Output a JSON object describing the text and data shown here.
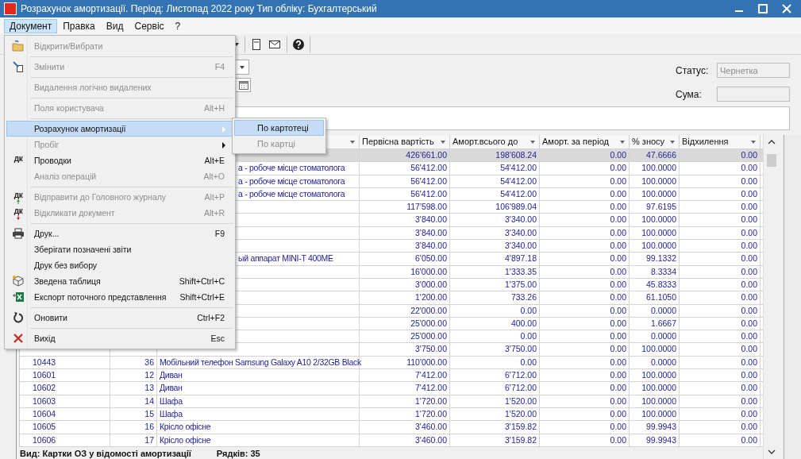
{
  "window": {
    "title": "Розрахунок амортизації. Період: Листопад 2022 року Тип обліку: Бухгалтерський"
  },
  "menubar": [
    {
      "label": "Документ",
      "selected": true
    },
    {
      "label": "Правка",
      "selected": false
    },
    {
      "label": "Вид",
      "selected": false
    },
    {
      "label": "Сервіс",
      "selected": false
    },
    {
      "label": "?",
      "selected": false
    }
  ],
  "menu": {
    "items": [
      {
        "kind": "item",
        "label": "Відкрити/Вибрати",
        "disabled": true,
        "selected": false,
        "submenu": false
      },
      {
        "kind": "separator"
      },
      {
        "kind": "item",
        "label": "Змінити",
        "shortcut": "F4",
        "disabled": true,
        "selected": false,
        "submenu": false
      },
      {
        "kind": "separator"
      },
      {
        "kind": "item",
        "label": "Видалення логічно видалених",
        "disabled": true,
        "selected": false,
        "submenu": false
      },
      {
        "kind": "separator"
      },
      {
        "kind": "item",
        "label": "Поля користувача",
        "shortcut": "Alt+H",
        "disabled": true,
        "selected": false,
        "submenu": false
      },
      {
        "kind": "separator"
      },
      {
        "kind": "item",
        "label": "Розрахунок амортизації",
        "disabled": false,
        "selected": true,
        "submenu": true
      },
      {
        "kind": "item",
        "label": "Пробіг",
        "disabled": true,
        "selected": false,
        "submenu": true
      },
      {
        "kind": "item",
        "label": "Проводки",
        "shortcut": "Alt+E",
        "icon_text": "дк",
        "disabled": false,
        "selected": false,
        "submenu": false
      },
      {
        "kind": "item",
        "label": "Аналіз операцій",
        "shortcut": "Alt+O",
        "disabled": true,
        "selected": false,
        "submenu": false
      },
      {
        "kind": "separator"
      },
      {
        "kind": "item",
        "label": "Відправити до Головного журналу",
        "shortcut": "Alt+P",
        "icon_text": "дк",
        "disabled": true,
        "selected": false,
        "submenu": false
      },
      {
        "kind": "item",
        "label": "Відкликати документ",
        "shortcut": "Alt+R",
        "icon_text": "дк",
        "disabled": true,
        "selected": false,
        "submenu": false
      },
      {
        "kind": "separator"
      },
      {
        "kind": "item",
        "label": "Друк...",
        "shortcut": "F9",
        "disabled": false,
        "selected": false,
        "submenu": false
      },
      {
        "kind": "item",
        "label": "Зберігати позначені звіти",
        "disabled": false,
        "selected": false,
        "submenu": false
      },
      {
        "kind": "item",
        "label": "Друк без вибору",
        "disabled": false,
        "selected": false,
        "submenu": false
      },
      {
        "kind": "item",
        "label": "Зведена таблиця",
        "shortcut": "Shift+Ctrl+C",
        "disabled": false,
        "selected": false,
        "submenu": false
      },
      {
        "kind": "item",
        "label": "Експорт поточного представлення",
        "shortcut": "Shift+Ctrl+E",
        "disabled": false,
        "selected": false,
        "submenu": false
      },
      {
        "kind": "separator"
      },
      {
        "kind": "item",
        "label": "Оновити",
        "shortcut": "Ctrl+F2",
        "disabled": false,
        "selected": false,
        "submenu": false
      },
      {
        "kind": "separator"
      },
      {
        "kind": "item",
        "label": "Вихід",
        "shortcut": "Esc",
        "disabled": false,
        "selected": false,
        "submenu": false
      }
    ]
  },
  "submenu": [
    {
      "label": "По картотеці",
      "selected": true,
      "disabled": false
    },
    {
      "label": "По картці",
      "selected": false,
      "disabled": true
    }
  ],
  "form": {
    "status_label": "Статус:",
    "status_value": "Чернетка",
    "sum_label": "Сума:"
  },
  "table": {
    "columns": [
      "Первісна вартість",
      "Аморт.всього до",
      "Аморт. за період",
      "% зносу",
      "Відхилення"
    ],
    "rows": [
      {
        "selected": true,
        "values": [
          "426'661.00",
          "198'608.24",
          "0.00",
          "47.6666",
          "0.00"
        ]
      },
      {
        "covered": true,
        "selected": false,
        "name": "а - робоче місце стоматолога",
        "values": [
          "56'412.00",
          "54'412.00",
          "0.00",
          "100.0000",
          "0.00"
        ]
      },
      {
        "covered": true,
        "selected": false,
        "name": "а - робоче місце стоматолога",
        "values": [
          "56'412.00",
          "54'412.00",
          "0.00",
          "100.0000",
          "0.00"
        ]
      },
      {
        "covered": true,
        "selected": false,
        "name": "а - робоче місце стоматолога",
        "values": [
          "56'412.00",
          "54'412.00",
          "0.00",
          "100.0000",
          "0.00"
        ]
      },
      {
        "selected": false,
        "values": [
          "117'598.00",
          "106'989.04",
          "0.00",
          "97.6195",
          "0.00"
        ]
      },
      {
        "selected": false,
        "values": [
          "3'840.00",
          "3'340.00",
          "0.00",
          "100.0000",
          "0.00"
        ]
      },
      {
        "selected": false,
        "values": [
          "3'840.00",
          "3'340.00",
          "0.00",
          "100.0000",
          "0.00"
        ]
      },
      {
        "selected": false,
        "values": [
          "3'840.00",
          "3'340.00",
          "0.00",
          "100.0000",
          "0.00"
        ]
      },
      {
        "covered": true,
        "selected": false,
        "name": "ый аппарат MINI-T 400ME",
        "values": [
          "6'050.00",
          "4'897.18",
          "0.00",
          "99.1332",
          "0.00"
        ]
      },
      {
        "selected": false,
        "values": [
          "16'000.00",
          "1'333.35",
          "0.00",
          "8.3334",
          "0.00"
        ]
      },
      {
        "selected": false,
        "values": [
          "3'000.00",
          "1'375.00",
          "0.00",
          "45.8333",
          "0.00"
        ]
      },
      {
        "selected": false,
        "values": [
          "1'200.00",
          "733.26",
          "0.00",
          "61.1050",
          "0.00"
        ]
      },
      {
        "selected": false,
        "values": [
          "22'000.00",
          "0.00",
          "0.00",
          "0.0000",
          "0.00"
        ]
      },
      {
        "selected": false,
        "values": [
          "25'000.00",
          "400.00",
          "0.00",
          "1.6667",
          "0.00"
        ]
      },
      {
        "selected": false,
        "values": [
          "25'000.00",
          "0.00",
          "0.00",
          "0.0000",
          "0.00"
        ]
      },
      {
        "selected": false,
        "values": [
          "3'750.00",
          "3'750.00",
          "0.00",
          "100.0000",
          "0.00"
        ]
      },
      {
        "covered": false,
        "selected": false,
        "code": "10443",
        "number": "36",
        "name": "Мобільний телефон Samsung Galaxy A10 2/32GB Black",
        "values": [
          "110'000.00",
          "0.00",
          "0.00",
          "0.0000",
          "0.00"
        ]
      },
      {
        "covered": false,
        "selected": false,
        "code": "10601",
        "number": "12",
        "name": "Диван",
        "values": [
          "7'412.00",
          "6'712.00",
          "0.00",
          "100.0000",
          "0.00"
        ]
      },
      {
        "covered": false,
        "selected": false,
        "code": "10602",
        "number": "13",
        "name": "Диван",
        "values": [
          "7'412.00",
          "6'712.00",
          "0.00",
          "100.0000",
          "0.00"
        ]
      },
      {
        "covered": false,
        "selected": false,
        "code": "10603",
        "number": "14",
        "name": "Шафа",
        "values": [
          "1'720.00",
          "1'520.00",
          "0.00",
          "100.0000",
          "0.00"
        ]
      },
      {
        "covered": false,
        "selected": false,
        "code": "10604",
        "number": "15",
        "name": "Шафа",
        "values": [
          "1'720.00",
          "1'520.00",
          "0.00",
          "100.0000",
          "0.00"
        ]
      },
      {
        "covered": false,
        "selected": false,
        "code": "10605",
        "number": "16",
        "name": "Крісло офісне",
        "values": [
          "3'460.00",
          "3'159.82",
          "0.00",
          "99.9943",
          "0.00"
        ]
      },
      {
        "covered": false,
        "selected": false,
        "code": "10606",
        "number": "17",
        "name": "Крісло офісне",
        "values": [
          "3'460.00",
          "3'159.82",
          "0.00",
          "99.9943",
          "0.00"
        ]
      }
    ]
  },
  "status_bar": {
    "view": "Вид: Картки ОЗ у відомості амортизації",
    "rows": "Рядків: 35"
  }
}
